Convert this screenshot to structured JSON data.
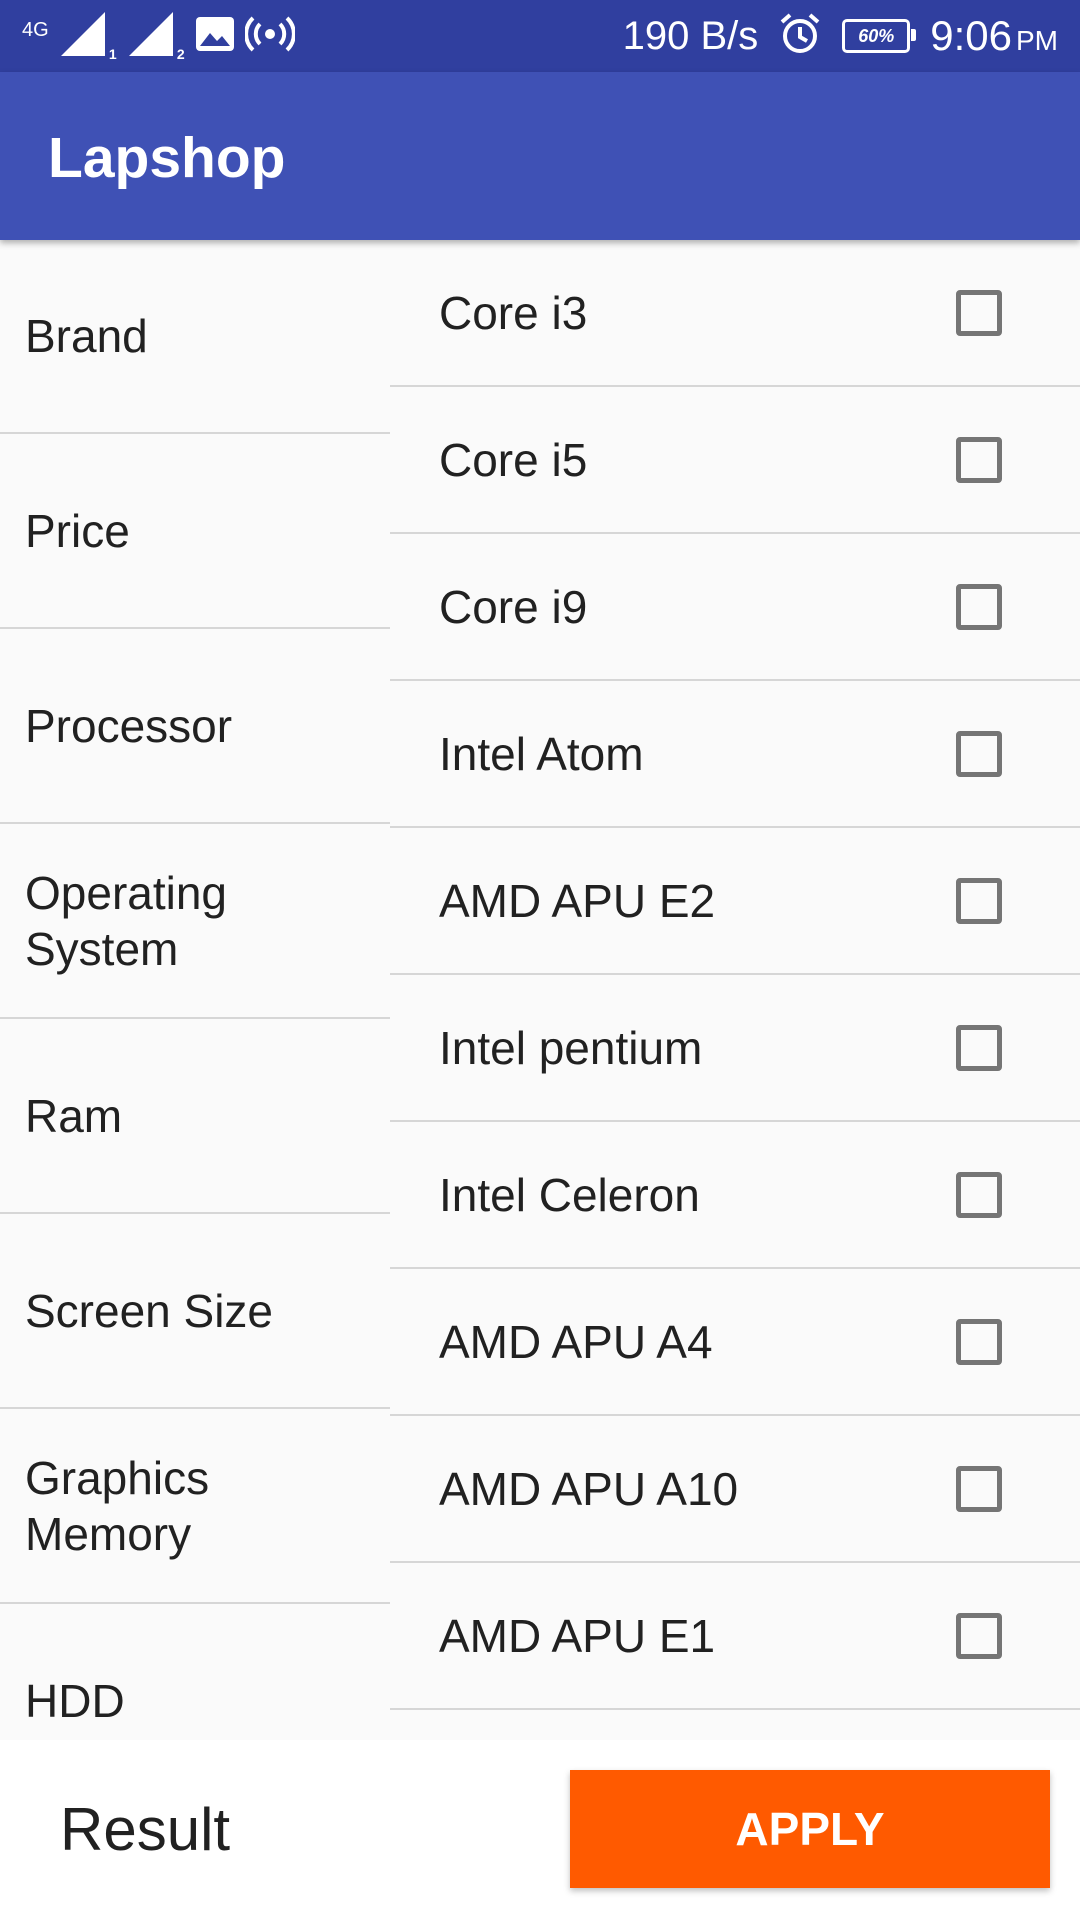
{
  "status_bar": {
    "network": "4G",
    "sim1": "1",
    "sim2": "2",
    "speed": "190 B/s",
    "battery": "60%",
    "time": "9:06",
    "ampm": "PM",
    "icons": [
      "signal-sim1-icon",
      "signal-sim2-icon",
      "image-notification-icon",
      "hotspot-icon",
      "alarm-icon",
      "battery-icon"
    ]
  },
  "app_bar": {
    "title": "Lapshop"
  },
  "categories": [
    {
      "label": "Brand"
    },
    {
      "label": "Price"
    },
    {
      "label": "Processor"
    },
    {
      "label": "Operating System"
    },
    {
      "label": "Ram"
    },
    {
      "label": "Screen Size"
    },
    {
      "label": "Graphics Memory"
    },
    {
      "label": "HDD"
    }
  ],
  "options": [
    {
      "label": "Core i3",
      "checked": false
    },
    {
      "label": "Core i5",
      "checked": false
    },
    {
      "label": "Core i9",
      "checked": false
    },
    {
      "label": "Intel Atom",
      "checked": false
    },
    {
      "label": "AMD APU E2",
      "checked": false
    },
    {
      "label": "Intel pentium",
      "checked": false
    },
    {
      "label": "Intel Celeron",
      "checked": false
    },
    {
      "label": "AMD APU A4",
      "checked": false
    },
    {
      "label": "AMD APU A10",
      "checked": false
    },
    {
      "label": "AMD APU E1",
      "checked": false
    }
  ],
  "bottom": {
    "result_label": "Result",
    "apply_label": "APPLY"
  },
  "colors": {
    "status_bar": "#303f9f",
    "app_bar": "#3f51b5",
    "apply_button": "#ff5a00"
  }
}
